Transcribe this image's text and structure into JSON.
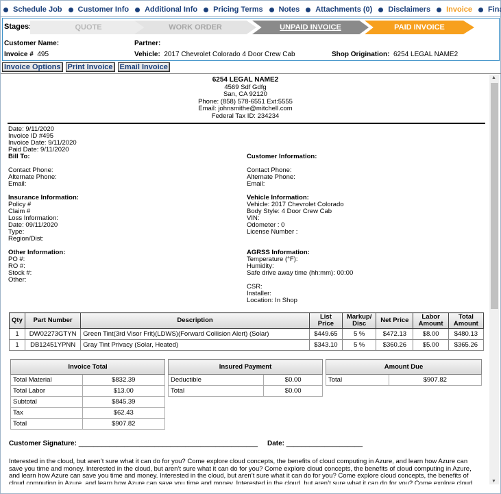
{
  "nav": {
    "items": [
      {
        "label": "Schedule Job"
      },
      {
        "label": "Customer Info"
      },
      {
        "label": "Additional Info"
      },
      {
        "label": "Pricing Terms"
      },
      {
        "label": "Notes"
      },
      {
        "label": "Attachments (0)"
      },
      {
        "label": "Disclaimers"
      },
      {
        "label": "Invoice"
      },
      {
        "label": "Finance"
      }
    ],
    "active": "Invoice"
  },
  "header": {
    "stages_label": "Stages:",
    "stages": [
      "QUOTE",
      "WORK ORDER",
      "UNPAID INVOICE",
      "PAID INVOICE"
    ],
    "customer_name_label": "Customer Name:",
    "partner_label": "Partner:",
    "invoice_label": "Invoice #",
    "invoice_value": "495",
    "vehicle_label": "Vehicle:",
    "vehicle_value": "2017 Chevrolet Colorado 4 Door Crew Cab",
    "shop_origination_label": "Shop Origination:",
    "shop_origination_value": "6254 LEGAL NAME2"
  },
  "toolbar": {
    "invoice_options": "Invoice Options",
    "print_invoice": "Print Invoice",
    "email_invoice": "Email Invoice"
  },
  "shop": {
    "name": "6254 LEGAL NAME2",
    "address1": "4569 Sdf Gdfg",
    "address2": "San, CA 92120",
    "phone": "Phone: (858) 578-6551 Ext:5555",
    "email": "Email: johnsmithe@mitchell.com",
    "tax_id": "Federal Tax ID: 234234"
  },
  "dates": {
    "date": "Date: 9/11/2020",
    "invoice_id": "Invoice ID #495",
    "invoice_date": "Invoice Date: 9/11/2020",
    "paid_date": "Paid Date: 9/11/2020"
  },
  "bill_to": {
    "heading": "Bill To:",
    "contact_phone": "Contact Phone:",
    "alternate_phone": "Alternate Phone:",
    "email": "Email:"
  },
  "customer_info": {
    "heading": "Customer Information:",
    "contact_phone": "Contact Phone:",
    "alternate_phone": "Alternate Phone:",
    "email": "Email:"
  },
  "insurance": {
    "heading": "Insurance Information:",
    "lines": [
      "Policy #",
      "Claim #",
      "Loss Information:",
      "Date: 09/11/2020",
      "Type:",
      "Region/Dist:"
    ]
  },
  "vehicle_info": {
    "heading": "Vehicle Information:",
    "lines": [
      "Vehicle: 2017 Chevrolet Colorado",
      "Body Style: 4 Door Crew Cab",
      "VIN:",
      "Odometer : 0",
      "License Number :"
    ]
  },
  "other": {
    "heading": "Other Information:",
    "lines": [
      "PO #:",
      "RO #:",
      "Stock #:",
      "Other:"
    ]
  },
  "agrss": {
    "heading": "AGRSS Information:",
    "lines": [
      "Temperature (°F):",
      "Humidity:",
      "Safe drive away time (hh:mm): 00:00",
      "",
      "CSR:",
      "Installer:",
      "Location: In Shop"
    ]
  },
  "items_table": {
    "headers": [
      "Qty",
      "Part Number",
      "Description",
      "List Price",
      "Markup/ Disc",
      "Net Price",
      "Labor Amount",
      "Total Amount"
    ],
    "rows": [
      [
        "1",
        "DW02273GTYN",
        "Green Tint(3rd Visor Frit)(LDWS)(Forward Collision Alert) (Solar)",
        "$449.65",
        "5 %",
        "$472.13",
        "$8.00",
        "$480.13"
      ],
      [
        "1",
        "DB12451YPNN",
        "Gray Tint Privacy (Solar, Heated)",
        "$343.10",
        "5 %",
        "$360.26",
        "$5.00",
        "$365.26"
      ]
    ]
  },
  "invoice_total": {
    "heading": "Invoice Total",
    "rows": [
      [
        "Total Material",
        "$832.39"
      ],
      [
        "Total Labor",
        "$13.00"
      ],
      [
        "Subtotal",
        "$845.39"
      ],
      [
        "Tax",
        "$62.43"
      ],
      [
        "Total",
        "$907.82"
      ]
    ]
  },
  "insured_payment": {
    "heading": "Insured Payment",
    "rows": [
      [
        "Deductible",
        "$0.00"
      ],
      [
        "Total",
        "$0.00"
      ]
    ]
  },
  "amount_due": {
    "heading": "Amount Due",
    "rows": [
      [
        "Total",
        "$907.82"
      ]
    ]
  },
  "signature": {
    "label": "Customer Signature:",
    "sig_line": "_______________________________________________",
    "date_label": "Date:",
    "date_line": "____________________"
  },
  "disclaimer": "Interested in the cloud, but aren’t sure what it can do for you? Come explore cloud concepts, the benefits of cloud computing in Azure, and learn how Azure can save you time and money. Interested in the cloud, but aren’t sure what it can do for you? Come explore cloud concepts, the benefits of cloud computing in Azure, and learn how Azure can save you time and money. Interested in the cloud, but aren’t sure what it can do for you? Come explore cloud concepts, the benefits of cloud computing in Azure, and learn how Azure can save you time and money. Interested in the cloud, but aren’t sure what it can do for you? Come explore cloud concepts, the benefits of cloud computing in Azure, and learn"
}
